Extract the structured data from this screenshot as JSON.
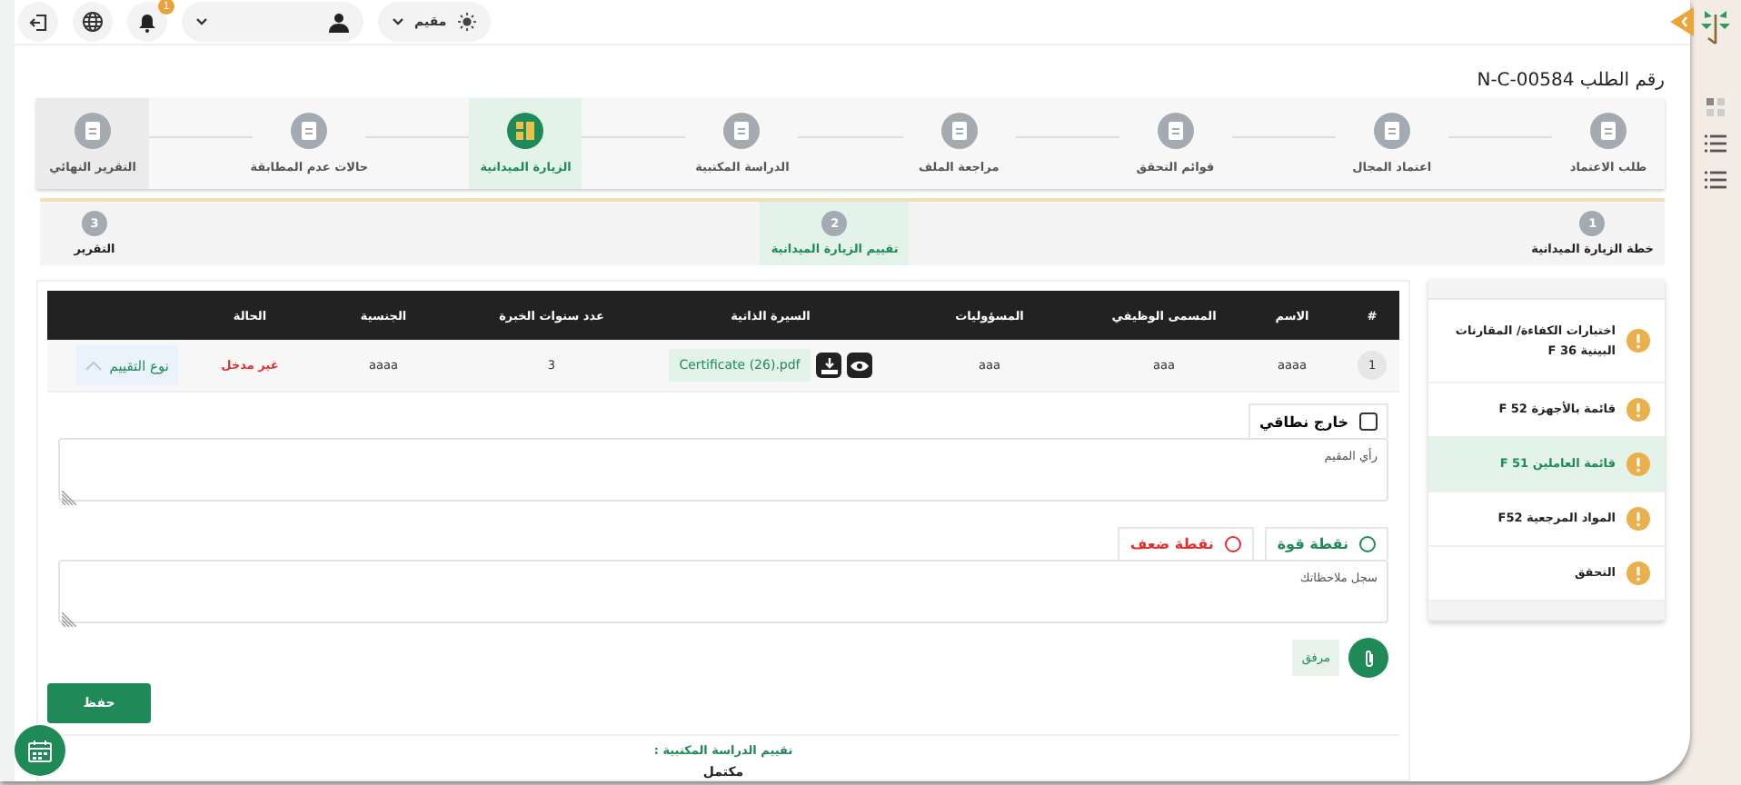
{
  "header": {
    "role": "مقيم",
    "notifications": "1"
  },
  "request_title": "رقم الطلب N-C-00584",
  "steps": [
    {
      "label": "طلب الاعتماد",
      "selected": false
    },
    {
      "label": "اعتماد المجال",
      "selected": false
    },
    {
      "label": "قوائم التحقق",
      "selected": false
    },
    {
      "label": "مراجعة الملف",
      "selected": false
    },
    {
      "label": "الدراسة المكتبية",
      "selected": false
    },
    {
      "label": "الزيارة الميدانية",
      "selected": true
    },
    {
      "label": "حالات عدم المطابقة",
      "selected": false
    },
    {
      "label": "التقرير النهائي",
      "selected": false
    }
  ],
  "substeps": [
    {
      "number": "1",
      "label": "خطة الزيارة الميدانية",
      "selected": false
    },
    {
      "number": "2",
      "label": "تقييم الزيارة الميدانية",
      "selected": true
    },
    {
      "number": "3",
      "label": "التقرير",
      "selected": false
    }
  ],
  "sections": [
    {
      "label": "اختبارات الكفاءة/ المقارنات البينية F 36",
      "selected": false
    },
    {
      "label": "قائمة بالأجهزة F 52",
      "selected": false
    },
    {
      "label": "قائمة العاملين F 51",
      "selected": true
    },
    {
      "label": "المواد المرجعية F52",
      "selected": false
    },
    {
      "label": "التحقق",
      "selected": false
    }
  ],
  "table": {
    "columns": [
      "#",
      "الاسم",
      "المسمى الوظيفي",
      "المسؤوليات",
      "السيرة الذاتية",
      "عدد سنوات الخبرة",
      "الجنسية",
      "الحالة"
    ],
    "rows": [
      {
        "index": "1",
        "name": "aaaa",
        "job_title": "aaa",
        "responsibilities": "aaa",
        "cv_file": "Certificate (26).pdf",
        "experience_years": "3",
        "nationality": "aaaa",
        "status": "غير مدخل",
        "action": "نوع التقييم",
        "expanded": true
      }
    ]
  },
  "evaluation": {
    "out_of_scope": {
      "label": "خارج نطاقي",
      "checked": false
    },
    "opinion": {
      "placeholder": "رأي المقيم"
    },
    "point_types": [
      {
        "label": "نقطة قوة",
        "kind": "strength",
        "selected": false
      },
      {
        "label": "نقطة ضعف",
        "kind": "weakness",
        "selected": false
      }
    ],
    "notes": {
      "placeholder": "سجل ملاحظاتك"
    },
    "attachment": "مرفق"
  },
  "save_button": "حفظ",
  "desk_study": {
    "label": "تقييم الدراسة المكتبية :",
    "value": "مكتمل"
  }
}
